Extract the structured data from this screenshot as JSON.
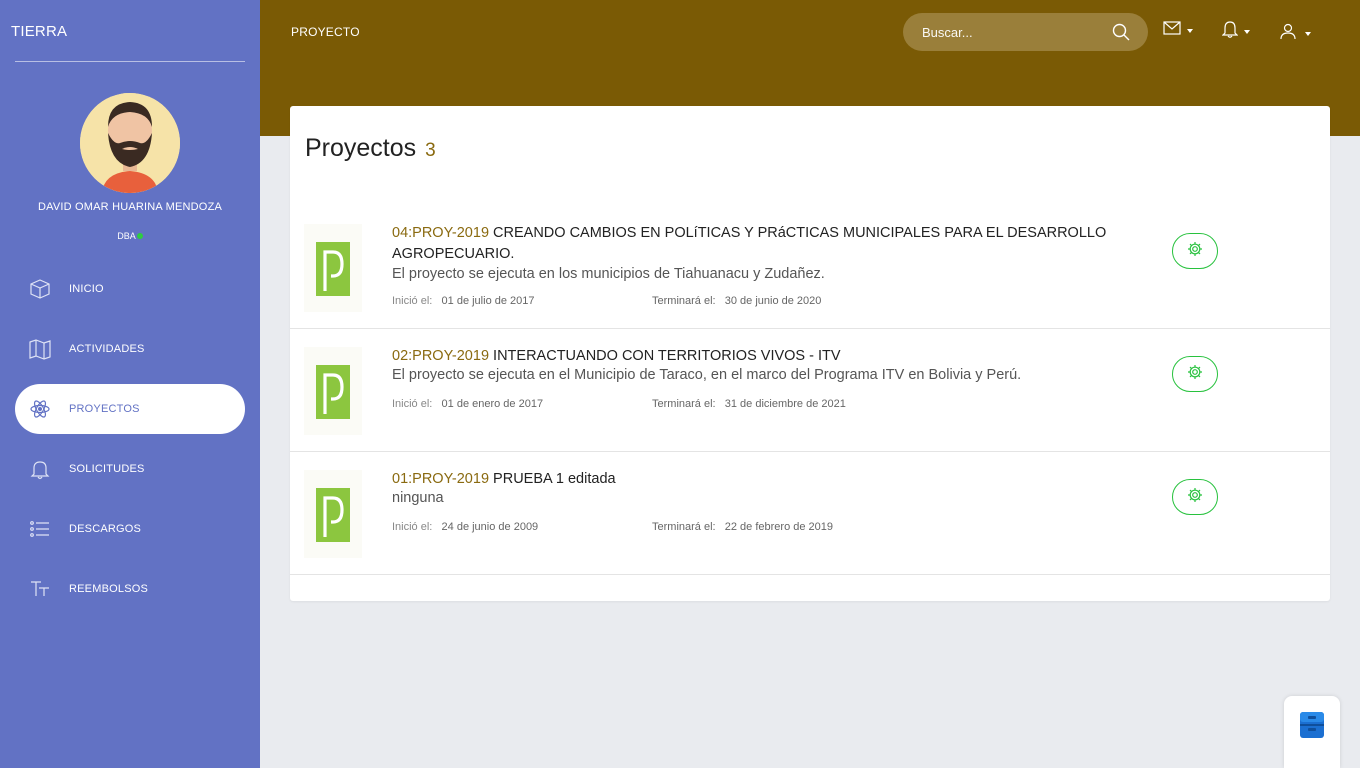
{
  "sidebar": {
    "brand": "TIERRA",
    "user": {
      "name": "DAVID OMAR HUARINA MENDOZA",
      "role": "DBA",
      "status_color": "#2ecc40"
    },
    "items": [
      {
        "label": "INICIO",
        "icon": "cube-icon"
      },
      {
        "label": "ACTIVIDADES",
        "icon": "map-icon"
      },
      {
        "label": "PROYECTOS",
        "icon": "atom-icon",
        "active": true
      },
      {
        "label": "SOLICITUDES",
        "icon": "bell-icon"
      },
      {
        "label": "DESCARGOS",
        "icon": "list-icon"
      },
      {
        "label": "REEMBOLSOS",
        "icon": "text-size-icon"
      }
    ]
  },
  "topbar": {
    "title": "PROYECTO",
    "search_placeholder": "Buscar..."
  },
  "main": {
    "title": "Proyectos",
    "count": "3",
    "start_label": "Inició el:",
    "end_label": "Terminará el:",
    "projects": [
      {
        "code": "04:PROY-2019",
        "name": "CREANDO CAMBIOS EN POLíTICAS Y PRáCTICAS MUNICIPALES PARA EL DESARROLLO AGROPECUARIO.",
        "description": "El proyecto se ejecuta en los municipios de Tiahuanacu y Zudañez.",
        "start": "01 de julio de 2017",
        "end": "30 de junio de 2020"
      },
      {
        "code": "02:PROY-2019",
        "name": "INTERACTUANDO CON TERRITORIOS VIVOS - ITV",
        "description": "El proyecto se ejecuta en el Municipio de Taraco, en el marco del Programa ITV en Bolivia y Perú.",
        "start": "01 de enero de 2017",
        "end": "31 de diciembre de 2021"
      },
      {
        "code": "01:PROY-2019",
        "name": "PRUEBA 1 editada",
        "description": "ninguna",
        "start": "24 de junio de 2009",
        "end": "22 de febrero de 2019"
      }
    ]
  },
  "colors": {
    "sidebar": "#6272c4",
    "topbar": "#7a5a05",
    "accent_code": "#8a6a10",
    "gear": "#28c23e",
    "logo_green": "#8cc63f"
  }
}
